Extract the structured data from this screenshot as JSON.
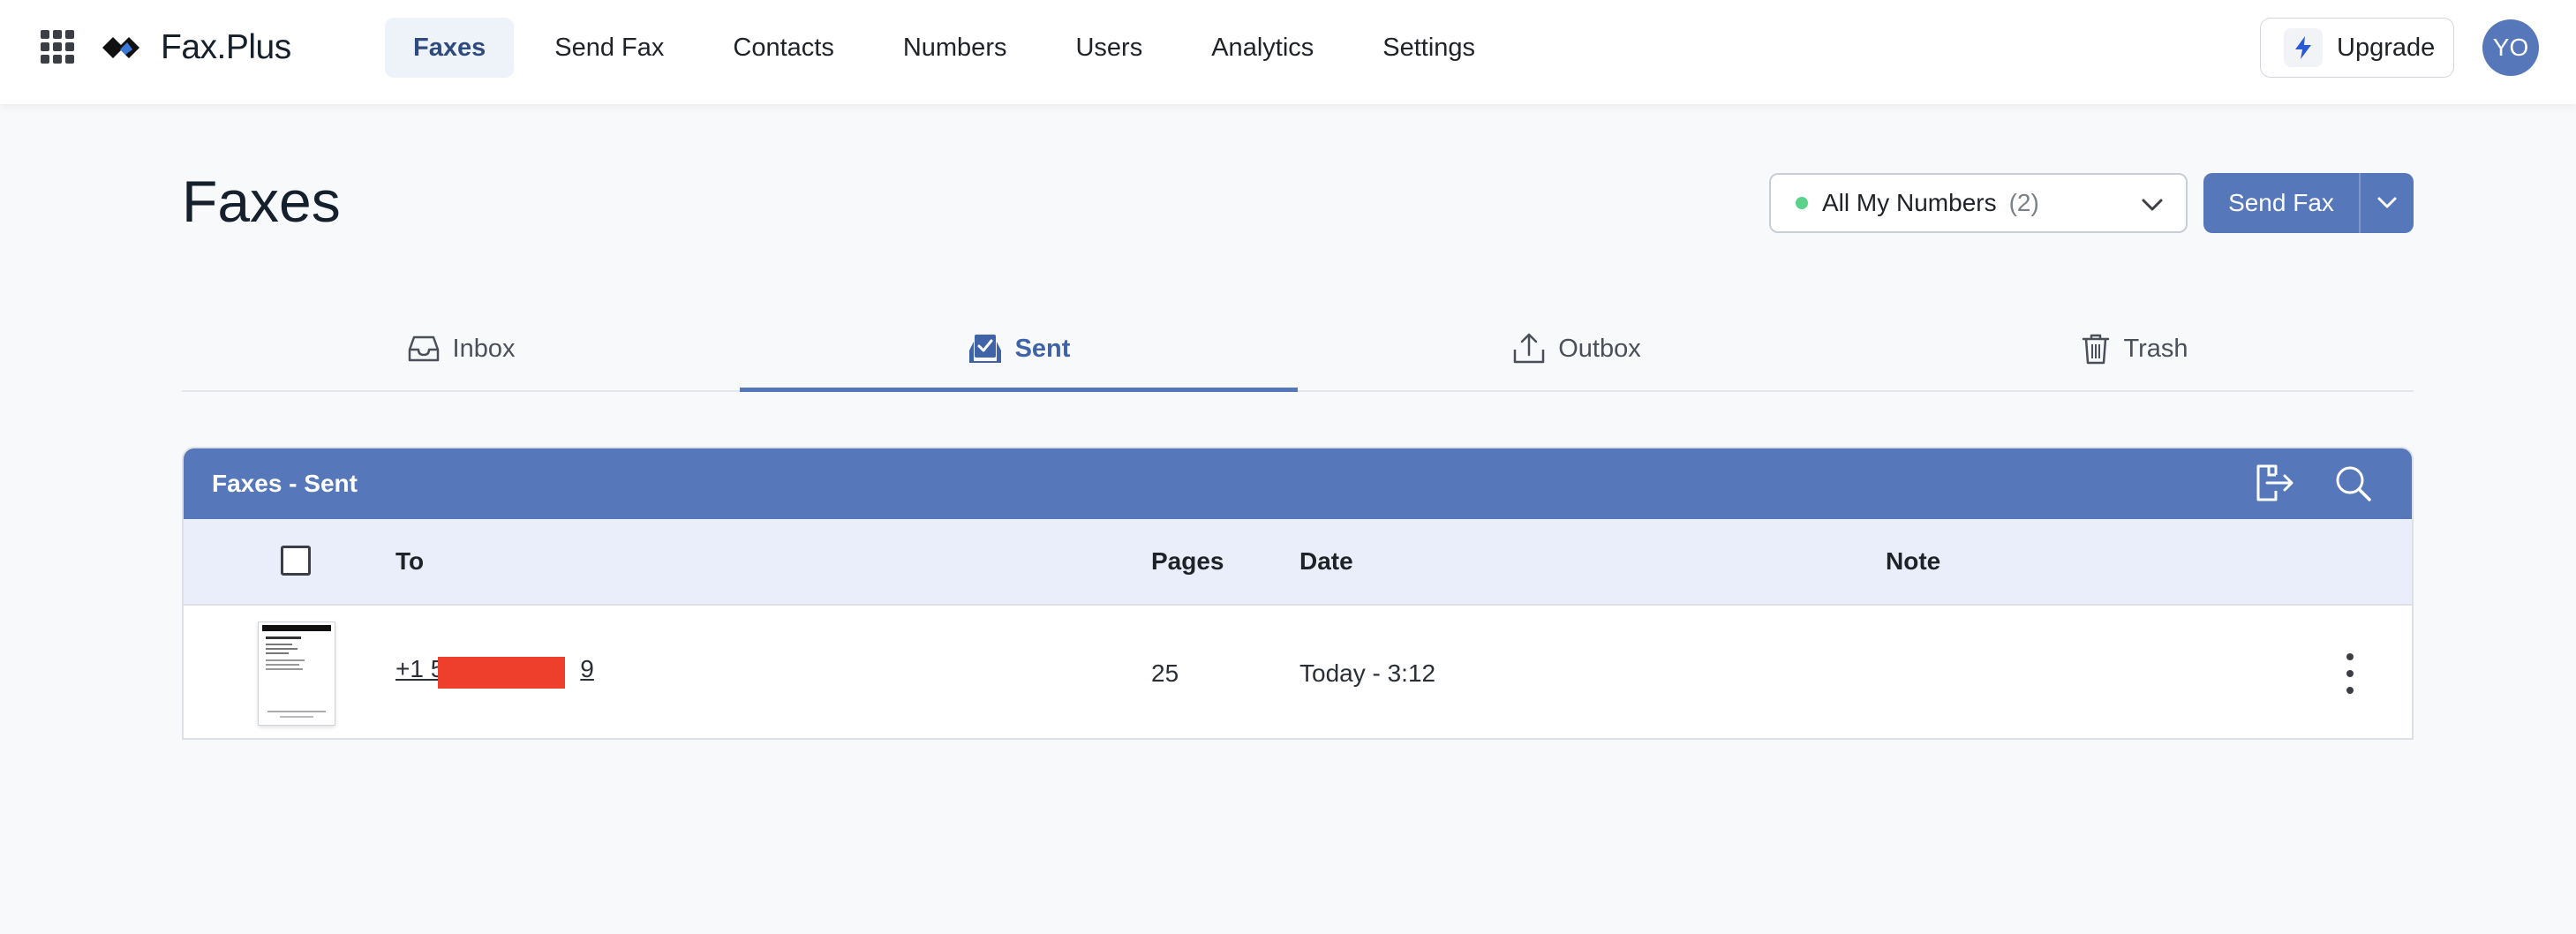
{
  "app": {
    "name": "Fax.Plus"
  },
  "nav": {
    "items": [
      {
        "label": "Faxes",
        "active": true
      },
      {
        "label": "Send Fax",
        "active": false
      },
      {
        "label": "Contacts",
        "active": false
      },
      {
        "label": "Numbers",
        "active": false
      },
      {
        "label": "Users",
        "active": false
      },
      {
        "label": "Analytics",
        "active": false
      },
      {
        "label": "Settings",
        "active": false
      }
    ]
  },
  "header": {
    "upgrade_label": "Upgrade",
    "avatar_initials": "YO"
  },
  "page": {
    "title": "Faxes"
  },
  "numbers_filter": {
    "label": "All My Numbers",
    "count": "(2)",
    "status_color": "#5ad28a"
  },
  "actions": {
    "send_fax_label": "Send Fax"
  },
  "tabs": [
    {
      "label": "Inbox",
      "icon": "inbox-icon",
      "active": false
    },
    {
      "label": "Sent",
      "icon": "sent-icon",
      "active": true
    },
    {
      "label": "Outbox",
      "icon": "outbox-icon",
      "active": false
    },
    {
      "label": "Trash",
      "icon": "trash-icon",
      "active": false
    }
  ],
  "panel": {
    "title": "Faxes - Sent",
    "columns": {
      "to": "To",
      "pages": "Pages",
      "date": "Date",
      "note": "Note"
    },
    "rows": [
      {
        "to_prefix": "+1 5",
        "to_suffix": "9",
        "pages": "25",
        "date": "Today - 3:12",
        "note": ""
      }
    ]
  },
  "colors": {
    "brand": "#5677b9",
    "redaction": "#ee3e2c"
  }
}
